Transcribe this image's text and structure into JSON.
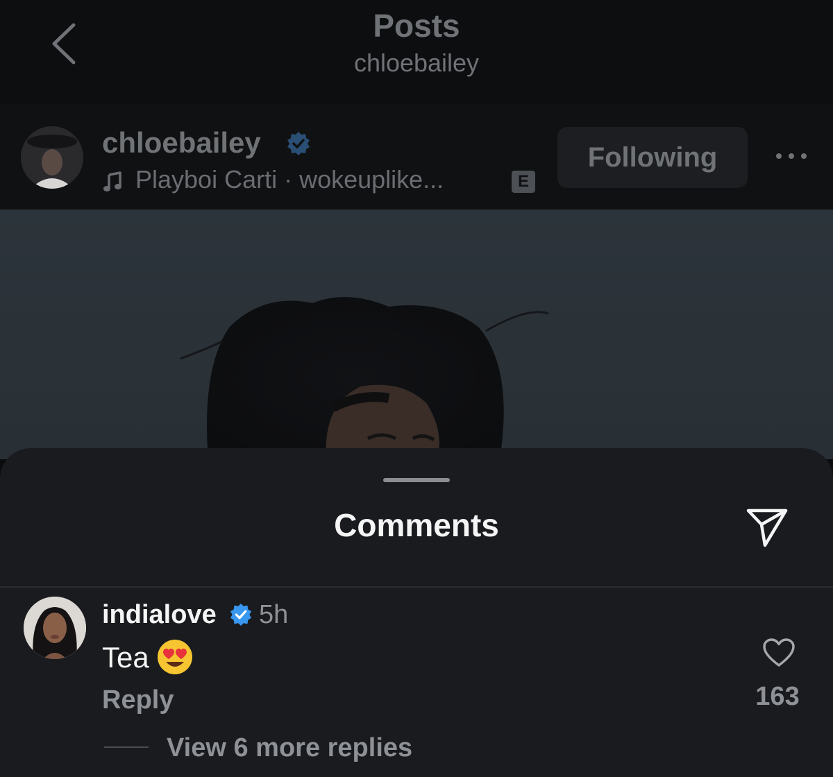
{
  "nav": {
    "title": "Posts",
    "subtitle": "chloebailey",
    "back_icon": "chevron-left-icon"
  },
  "post": {
    "username": "chloebailey",
    "verified": true,
    "music": "Playboi Carti · wokeuplike...",
    "explicit_badge": "E",
    "follow_label": "Following",
    "more_icon": "more-horizontal-icon"
  },
  "comments_sheet": {
    "title": "Comments",
    "share_icon": "send-icon",
    "comments": [
      {
        "username": "indialove",
        "verified": true,
        "time": "5h",
        "text": "Tea",
        "emoji": "😍",
        "reply_label": "Reply",
        "likes": "163",
        "view_replies_label": "View 6 more replies"
      }
    ]
  },
  "colors": {
    "background": "#0b0c0e",
    "sheet": "#191b1f",
    "verified_blue": "#3897f0",
    "muted_text": "#8e9196"
  }
}
